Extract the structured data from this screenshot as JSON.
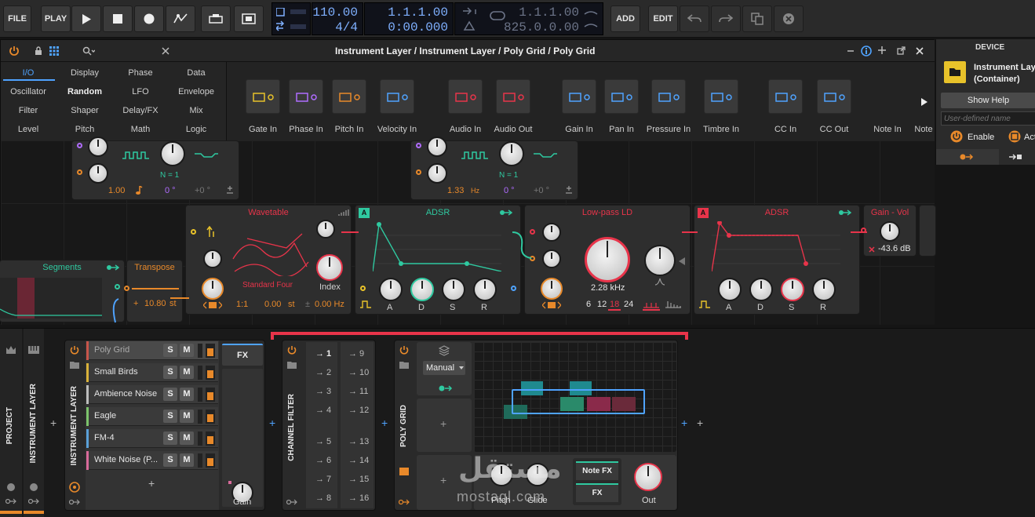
{
  "toolbar": {
    "file": "FILE",
    "play": "PLAY",
    "add": "ADD",
    "edit": "EDIT",
    "tempo": "110.00",
    "signature": "4/4",
    "position_bars": "1.1.1.00",
    "position_time": "0:00.000",
    "loop_start": "1.1.1.00",
    "loop_length": "825.0.0.00"
  },
  "device_window": {
    "title": "Instrument Layer / Instrument Layer / Poly Grid / Poly Grid",
    "browser": [
      [
        "I/O",
        "Display",
        "Phase",
        "Data"
      ],
      [
        "Oscillator",
        "Random",
        "LFO",
        "Envelope"
      ],
      [
        "Filter",
        "Shaper",
        "Delay/FX",
        "Mix"
      ],
      [
        "Level",
        "Pitch",
        "Math",
        "Logic"
      ]
    ],
    "io_modules": [
      "Gate In",
      "Phase In",
      "Pitch In",
      "Velocity In",
      "Audio In",
      "Audio Out",
      "Gain In",
      "Pan In",
      "Pressure In",
      "Timbre In",
      "CC In",
      "CC Out",
      "Note In",
      "Note"
    ]
  },
  "modules": {
    "lfo1": {
      "rate": "1.00",
      "nlabel": "N = 1",
      "phase": "0 °",
      "offset": "+0 °"
    },
    "lfo2": {
      "rate": "1.33",
      "unit": "Hz",
      "nlabel": "N = 1",
      "phase": "0 °",
      "offset": "+0 °"
    },
    "segments": {
      "title": "Segments"
    },
    "transpose": {
      "title": "Transpose",
      "value": "10.80",
      "unit": "st"
    },
    "wavetable": {
      "title": "Wavetable",
      "table": "Standard Four",
      "ratio": "1:1",
      "st": "0.00",
      "st_unit": "st",
      "hz": "0.00 Hz",
      "index": "Index"
    },
    "adsr1": {
      "title": "ADSR",
      "badge": "A",
      "a": "A",
      "d": "D",
      "s": "S",
      "r": "R"
    },
    "lowpass": {
      "title": "Low-pass LD",
      "freq": "2.28 kHz",
      "poles": [
        "6",
        "12",
        "18",
        "24"
      ]
    },
    "adsr2": {
      "title": "ADSR",
      "badge": "A",
      "a": "A",
      "d": "D",
      "s": "S",
      "r": "R"
    },
    "gain": {
      "title": "Gain - Vol",
      "value": "-43.6 dB"
    }
  },
  "device_panel": {
    "header": "DEVICE",
    "name_line1": "Instrument Layer",
    "name_line2": "(Container)",
    "show_help": "Show Help",
    "user_name_placeholder": "User-defined name",
    "enable": "Enable",
    "act": "Act"
  },
  "chain": {
    "project": "PROJECT",
    "instrument_layer_outer": "INSTRUMENT LAYER",
    "instrument_layer_inner": "INSTRUMENT LAYER",
    "layers": [
      "Poly Grid",
      "Small Birds",
      "Ambience Noise",
      "Eagle",
      "FM-4",
      "White Noise (P..."
    ],
    "layer_colors": [
      "#c8554a",
      "#d9b23a",
      "#bdbdbd",
      "#7cc36c",
      "#5aa0d8",
      "#d86a9a"
    ],
    "fx": "FX",
    "gain": "Gain",
    "channel_filter": "CHANNEL FILTER",
    "channels_left": [
      "→ 1",
      "→ 2",
      "→ 3",
      "→ 4",
      "→ 5",
      "→ 6",
      "→ 7",
      "→ 8"
    ],
    "channels_right": [
      "→ 9",
      "→ 10",
      "→ 11",
      "→ 12",
      "→ 13",
      "→ 14",
      "→ 15",
      "→ 16"
    ],
    "poly_grid": "POLY GRID",
    "mode": "Manual",
    "pitch": "Pitch",
    "glide": "Glide",
    "note_fx": "Note FX",
    "fx2": "FX",
    "out": "Out",
    "s": "S",
    "m": "M",
    "plus": "+"
  },
  "watermark": {
    "arabic": "مستقل",
    "latin": "mostaql.com"
  },
  "colors": {
    "accent": "#e8892a",
    "teal": "#2fc9a0",
    "red": "#e8344a",
    "blue": "#4fa3ff",
    "purple": "#b06cff"
  }
}
